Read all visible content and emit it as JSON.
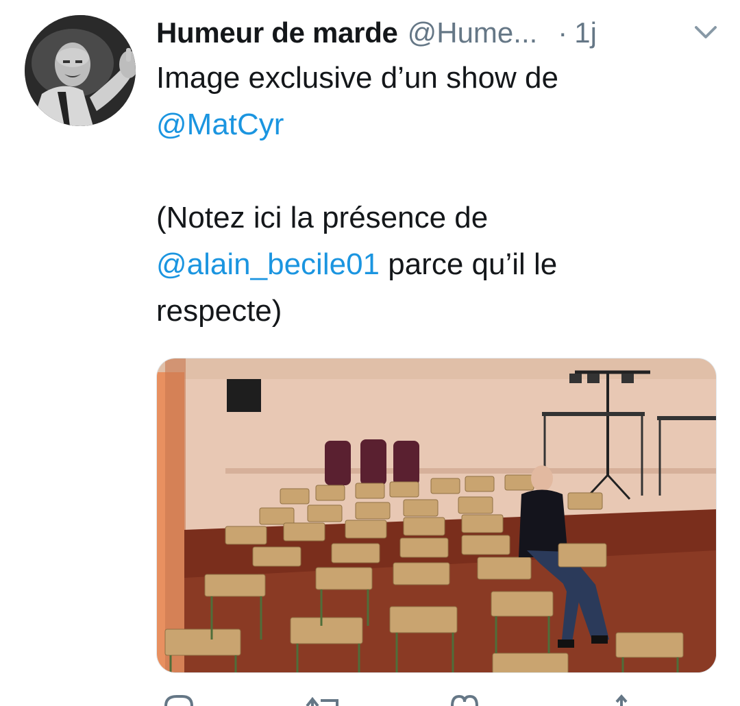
{
  "tweet": {
    "display_name": "Humeur de marde",
    "handle": "@Hume...",
    "separator": "·",
    "time": "1j",
    "text": {
      "line1": "Image exclusive d’un show de",
      "mention1": "@MatCyr",
      "line2": "(Notez ici la présence de",
      "mention2": "@alain_becile01",
      "line2_cont": " parce qu’il le",
      "line3": "respecte)"
    },
    "media": {
      "description_icon": "photo"
    }
  },
  "icons": {
    "chevron": "chevron-down-icon",
    "reply": "reply-icon",
    "retweet": "retweet-icon",
    "like": "heart-icon",
    "share": "share-icon"
  },
  "colors": {
    "link": "#1b95e0",
    "secondary_text": "#657786",
    "primary_text": "#14171a"
  }
}
